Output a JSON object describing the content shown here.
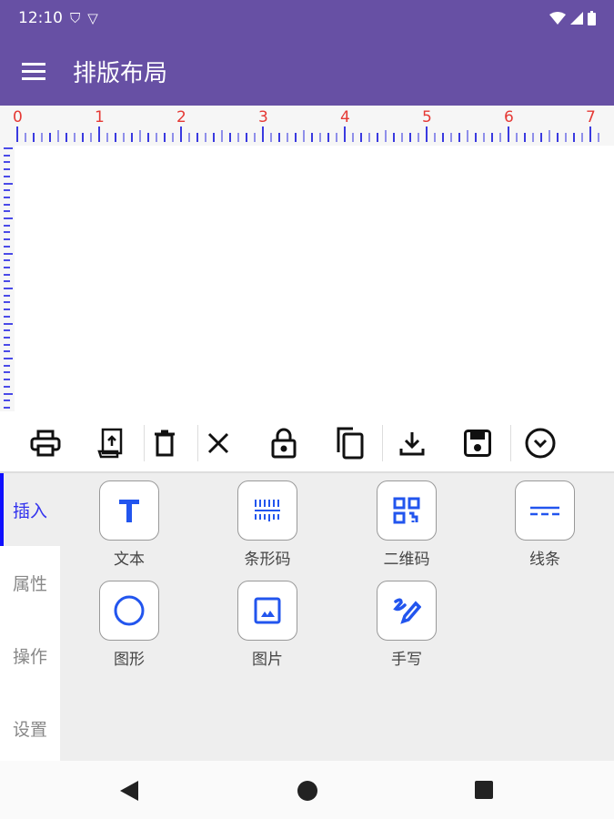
{
  "status": {
    "time": "12:10"
  },
  "appbar": {
    "title": "排版布局"
  },
  "ruler": {
    "labels": [
      "0",
      "1",
      "2",
      "3",
      "4",
      "5",
      "6",
      "7"
    ]
  },
  "side_tabs": [
    {
      "label": "插入",
      "active": true
    },
    {
      "label": "属性"
    },
    {
      "label": "操作"
    },
    {
      "label": "设置"
    }
  ],
  "insert_items": [
    {
      "label": "文本",
      "icon": "text-icon"
    },
    {
      "label": "条形码",
      "icon": "barcode-icon"
    },
    {
      "label": "二维码",
      "icon": "qrcode-icon"
    },
    {
      "label": "线条",
      "icon": "line-icon"
    },
    {
      "label": "图形",
      "icon": "circle-icon"
    },
    {
      "label": "图片",
      "icon": "image-icon"
    },
    {
      "label": "手写",
      "icon": "handwriting-icon"
    }
  ],
  "colors": {
    "appbar": "#6750a4",
    "accent": "#2255ee",
    "ruler_numbers": "#e53935"
  }
}
